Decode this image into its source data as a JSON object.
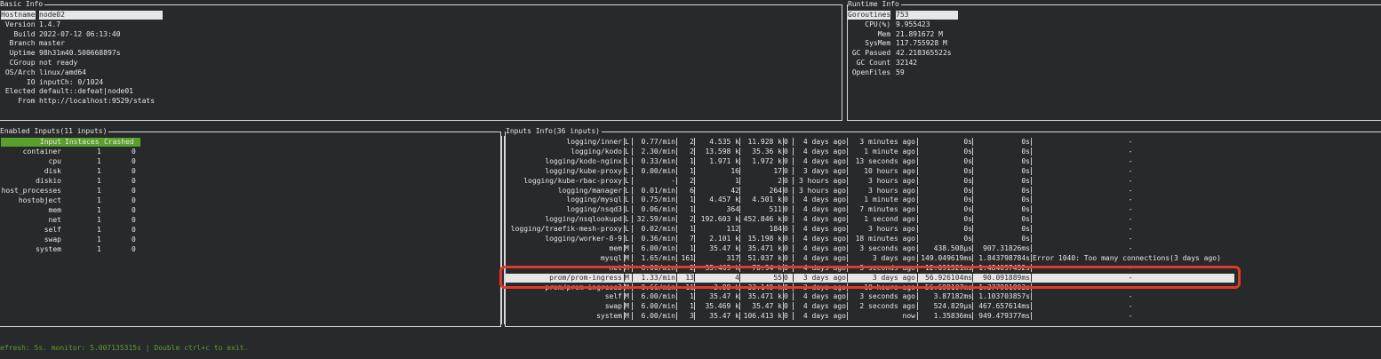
{
  "basic": {
    "title": "Basic Info",
    "rows": [
      {
        "label": "Hostname",
        "value": "node02"
      },
      {
        "label": " Version",
        "value": "1.4.7"
      },
      {
        "label": "   Build",
        "value": "2022-07-12 06:13:40"
      },
      {
        "label": "  Branch",
        "value": "master"
      },
      {
        "label": "  Uptime",
        "value": "98h31m40.500668897s"
      },
      {
        "label": "  CGroup",
        "value": "not ready"
      },
      {
        "label": " OS/Arch",
        "value": "linux/amd64"
      },
      {
        "label": "      IO",
        "value": "inputCh: 0/1024"
      },
      {
        "label": " Elected",
        "value": "default::defeat|node01"
      },
      {
        "label": "    From",
        "value": "http://localhost:9529/stats"
      }
    ]
  },
  "runtime": {
    "title": "Runtime Info",
    "rows": [
      {
        "label": "Goroutines",
        "value": "753"
      },
      {
        "label": "    CPU(%)",
        "value": "9.955423"
      },
      {
        "label": "       Mem",
        "value": "21.891672 M"
      },
      {
        "label": "    SysMem",
        "value": "117.755928 M"
      },
      {
        "label": " GC Pasued",
        "value": "42.218365522s"
      },
      {
        "label": "  GC Count",
        "value": "32142"
      },
      {
        "label": " OpenFiles",
        "value": "59"
      }
    ]
  },
  "enabled": {
    "title": "Enabled Inputs(11 inputs)",
    "header": {
      "input": "Input",
      "instances": "Instaces",
      "crashed": "Crashed"
    },
    "rows": [
      {
        "name": "container",
        "instances": "1",
        "crashed": "0"
      },
      {
        "name": "cpu",
        "instances": "1",
        "crashed": "0"
      },
      {
        "name": "disk",
        "instances": "1",
        "crashed": "0"
      },
      {
        "name": "diskio",
        "instances": "1",
        "crashed": "0"
      },
      {
        "name": "host_processes",
        "instances": "1",
        "crashed": "0"
      },
      {
        "name": "hostobject",
        "instances": "1",
        "crashed": "0"
      },
      {
        "name": "mem",
        "instances": "1",
        "crashed": "0"
      },
      {
        "name": "net",
        "instances": "1",
        "crashed": "0"
      },
      {
        "name": "self",
        "instances": "1",
        "crashed": "0"
      },
      {
        "name": "swap",
        "instances": "1",
        "crashed": "0"
      },
      {
        "name": "system",
        "instances": "1",
        "crashed": "0"
      }
    ]
  },
  "inputs": {
    "title": "Inputs Info(36 inputs)",
    "rows": [
      {
        "name": "logging/inner",
        "cat": "L",
        "freq": "0.77/min",
        "n": "2",
        "pts": "4.535 k",
        "total": "11.928 k",
        "err": "0",
        "first": "4 days ago",
        "last": "3 minutes ago",
        "avg": "0s",
        "max": "0s",
        "msg": "-"
      },
      {
        "name": "logging/kodo",
        "cat": "L",
        "freq": "2.30/min",
        "n": "2",
        "pts": "13.598 k",
        "total": "35.36 k",
        "err": "0",
        "first": "4 days ago",
        "last": "1 minute ago",
        "avg": "0s",
        "max": "0s",
        "msg": "-"
      },
      {
        "name": "logging/kodo-nginx",
        "cat": "L",
        "freq": "0.33/min",
        "n": "1",
        "pts": "1.971 k",
        "total": "1.972 k",
        "err": "0",
        "first": "4 days ago",
        "last": "13 seconds ago",
        "avg": "0s",
        "max": "0s",
        "msg": "-"
      },
      {
        "name": "logging/kube-proxy",
        "cat": "L",
        "freq": "0.00/min",
        "n": "1",
        "pts": "16",
        "total": "17",
        "err": "0",
        "first": "3 days ago",
        "last": "10 hours ago",
        "avg": "0s",
        "max": "0s",
        "msg": "-"
      },
      {
        "name": "logging/kube-rbac-proxy",
        "cat": "L",
        "freq": "-",
        "n": "2",
        "pts": "1",
        "total": "2",
        "err": "0",
        "first": "3 hours ago",
        "last": "3 hours ago",
        "avg": "0s",
        "max": "0s",
        "msg": "-"
      },
      {
        "name": "logging/manager",
        "cat": "L",
        "freq": "0.01/min",
        "n": "6",
        "pts": "42",
        "total": "264",
        "err": "0",
        "first": "3 hours ago",
        "last": "3 hours ago",
        "avg": "0s",
        "max": "0s",
        "msg": "-"
      },
      {
        "name": "logging/mysql",
        "cat": "L",
        "freq": "0.75/min",
        "n": "1",
        "pts": "4.457 k",
        "total": "4.501 k",
        "err": "0",
        "first": "4 days ago",
        "last": "1 minute ago",
        "avg": "0s",
        "max": "0s",
        "msg": "-"
      },
      {
        "name": "logging/nsqd3",
        "cat": "L",
        "freq": "0.06/min",
        "n": "1",
        "pts": "364",
        "total": "511",
        "err": "0",
        "first": "4 days ago",
        "last": "7 minutes ago",
        "avg": "0s",
        "max": "0s",
        "msg": "-"
      },
      {
        "name": "logging/nsqlookupd",
        "cat": "L",
        "freq": "32.59/min",
        "n": "2",
        "pts": "192.603 k",
        "total": "452.846 k",
        "err": "0",
        "first": "4 days ago",
        "last": "1 second ago",
        "avg": "0s",
        "max": "0s",
        "msg": "-"
      },
      {
        "name": "logging/traefik-mesh-proxy",
        "cat": "L",
        "freq": "0.02/min",
        "n": "1",
        "pts": "112",
        "total": "184",
        "err": "0",
        "first": "4 days ago",
        "last": "3 hours ago",
        "avg": "0s",
        "max": "0s",
        "msg": "-"
      },
      {
        "name": "logging/worker-8-9",
        "cat": "L",
        "freq": "0.36/min",
        "n": "7",
        "pts": "2.101 k",
        "total": "15.198 k",
        "err": "0",
        "first": "4 days ago",
        "last": "18 minutes ago",
        "avg": "0s",
        "max": "0s",
        "msg": "-"
      },
      {
        "name": "mem",
        "cat": "M",
        "freq": "6.00/min",
        "n": "1",
        "pts": "35.47 k",
        "total": "35.471 k",
        "err": "0",
        "first": "4 days ago",
        "last": "3 seconds ago",
        "avg": "438.508µs",
        "max": "907.31826ms",
        "msg": "-"
      },
      {
        "name": "mysql",
        "cat": "M",
        "freq": "1.65/min",
        "n": "161",
        "pts": "317",
        "total": "51.037 k",
        "err": "0",
        "first": "4 days ago",
        "last": "3 days ago",
        "avg": "149.049619ms",
        "max": "1.843798784s",
        "msg": "Error 1040: Too many connections(3 days ago)"
      },
      {
        "name": "net",
        "cat": "M",
        "freq": "6.00/min",
        "n": "2",
        "pts": "35.469 k",
        "total": "70.94 k",
        "err": "0",
        "first": "4 days ago",
        "last": "3 seconds ago",
        "avg": "12.091521ms",
        "max": "1.484097432s",
        "msg": "-"
      },
      {
        "name": "prom/prom-ingress",
        "cat": "M",
        "freq": "1.33/min",
        "n": "13",
        "pts": "4",
        "total": "55",
        "err": "0",
        "first": "3 days ago",
        "last": "3 days ago",
        "avg": "56.926104ms",
        "max": "90.091889ms",
        "msg": "-",
        "highlight": true
      },
      {
        "name": "prom/prom-ingress2",
        "cat": "M",
        "freq": "0.66/min",
        "n": "11",
        "pts": "2.88 k",
        "total": "33.149 k",
        "err": "0",
        "first": "3 days ago",
        "last": "10 hours ago",
        "avg": "56.699107ms",
        "max": "1.377901002s",
        "msg": "-"
      },
      {
        "name": "self",
        "cat": "M",
        "freq": "6.00/min",
        "n": "1",
        "pts": "35.47 k",
        "total": "35.471 k",
        "err": "0",
        "first": "4 days ago",
        "last": "3 seconds ago",
        "avg": "3.87182ms",
        "max": "1.103703857s",
        "msg": "-"
      },
      {
        "name": "swap",
        "cat": "M",
        "freq": "6.00/min",
        "n": "1",
        "pts": "35.469 k",
        "total": "35.47 k",
        "err": "0",
        "first": "4 days ago",
        "last": "2 seconds ago",
        "avg": "524.829µs",
        "max": "467.657614ms",
        "msg": "-"
      },
      {
        "name": "system",
        "cat": "M",
        "freq": "6.00/min",
        "n": "3",
        "pts": "35.47 k",
        "total": "106.413 k",
        "err": "0",
        "first": "4 days ago",
        "last": "now",
        "avg": "1.35836ms",
        "max": "949.479377ms",
        "msg": "-"
      }
    ]
  },
  "footer": "efresh: 5s. monitor: 5.007135315s | Double ctrl+c to exit."
}
